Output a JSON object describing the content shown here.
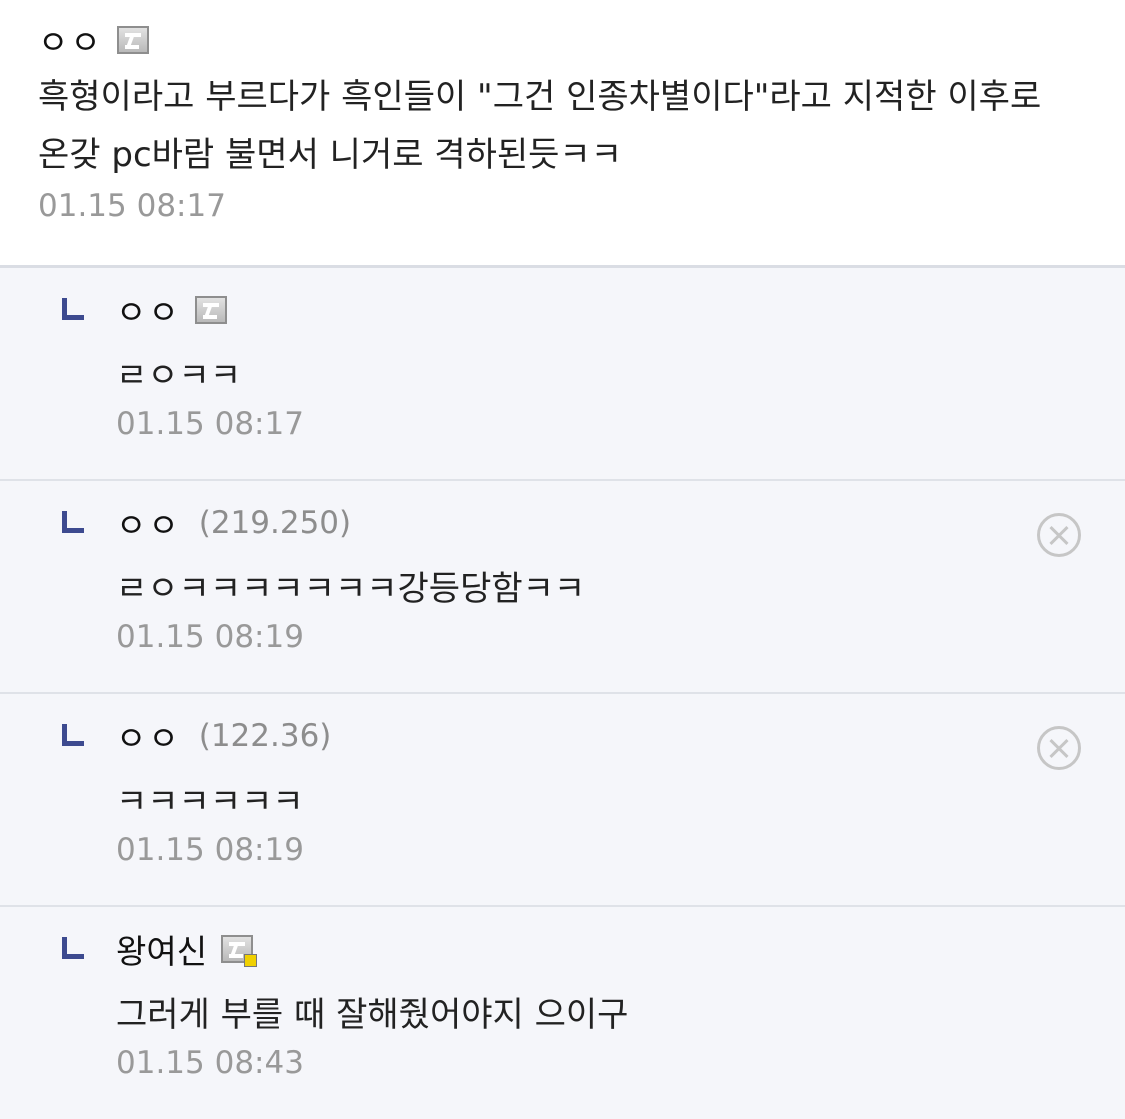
{
  "comments": [
    {
      "nickname": "ㅇㅇ",
      "badge_icon": "fixed-nick-badge-icon",
      "text": "흑형이라고 부르다가 흑인들이 \"그건 인종차별이다\"라고 지적한 이후로 온갖 pc바람 불면서 니거로 격하된듯ㅋㅋ",
      "time": "01.15 08:17"
    }
  ],
  "replies": [
    {
      "nickname": "ㅇㅇ",
      "badge_icon": "fixed-nick-badge-icon",
      "text": "ㄹㅇㅋㅋ",
      "time": "01.15 08:17"
    },
    {
      "nickname": "ㅇㅇ",
      "ip": "(219.250)",
      "delete_icon": "close-circle-icon",
      "text": "ㄹㅇㅋㅋㅋㅋㅋㅋㅋ강등당함ㅋㅋ",
      "time": "01.15 08:19"
    },
    {
      "nickname": "ㅇㅇ",
      "ip": "(122.36)",
      "delete_icon": "close-circle-icon",
      "text": "ㅋㅋㅋㅋㅋㅋ",
      "time": "01.15 08:19"
    },
    {
      "nickname": "왕여신",
      "badge_icon": "semi-fixed-nick-badge-icon",
      "text": "그러게 부를 때 잘해줬어야지 으이구",
      "time": "01.15 08:43"
    }
  ],
  "colors": {
    "reply_background": "#f5f6fa",
    "reply_arrow": "#3d4a8f",
    "timestamp": "#999999",
    "ip_text": "#8d8d8d",
    "badge_dot": "#f0d000"
  }
}
